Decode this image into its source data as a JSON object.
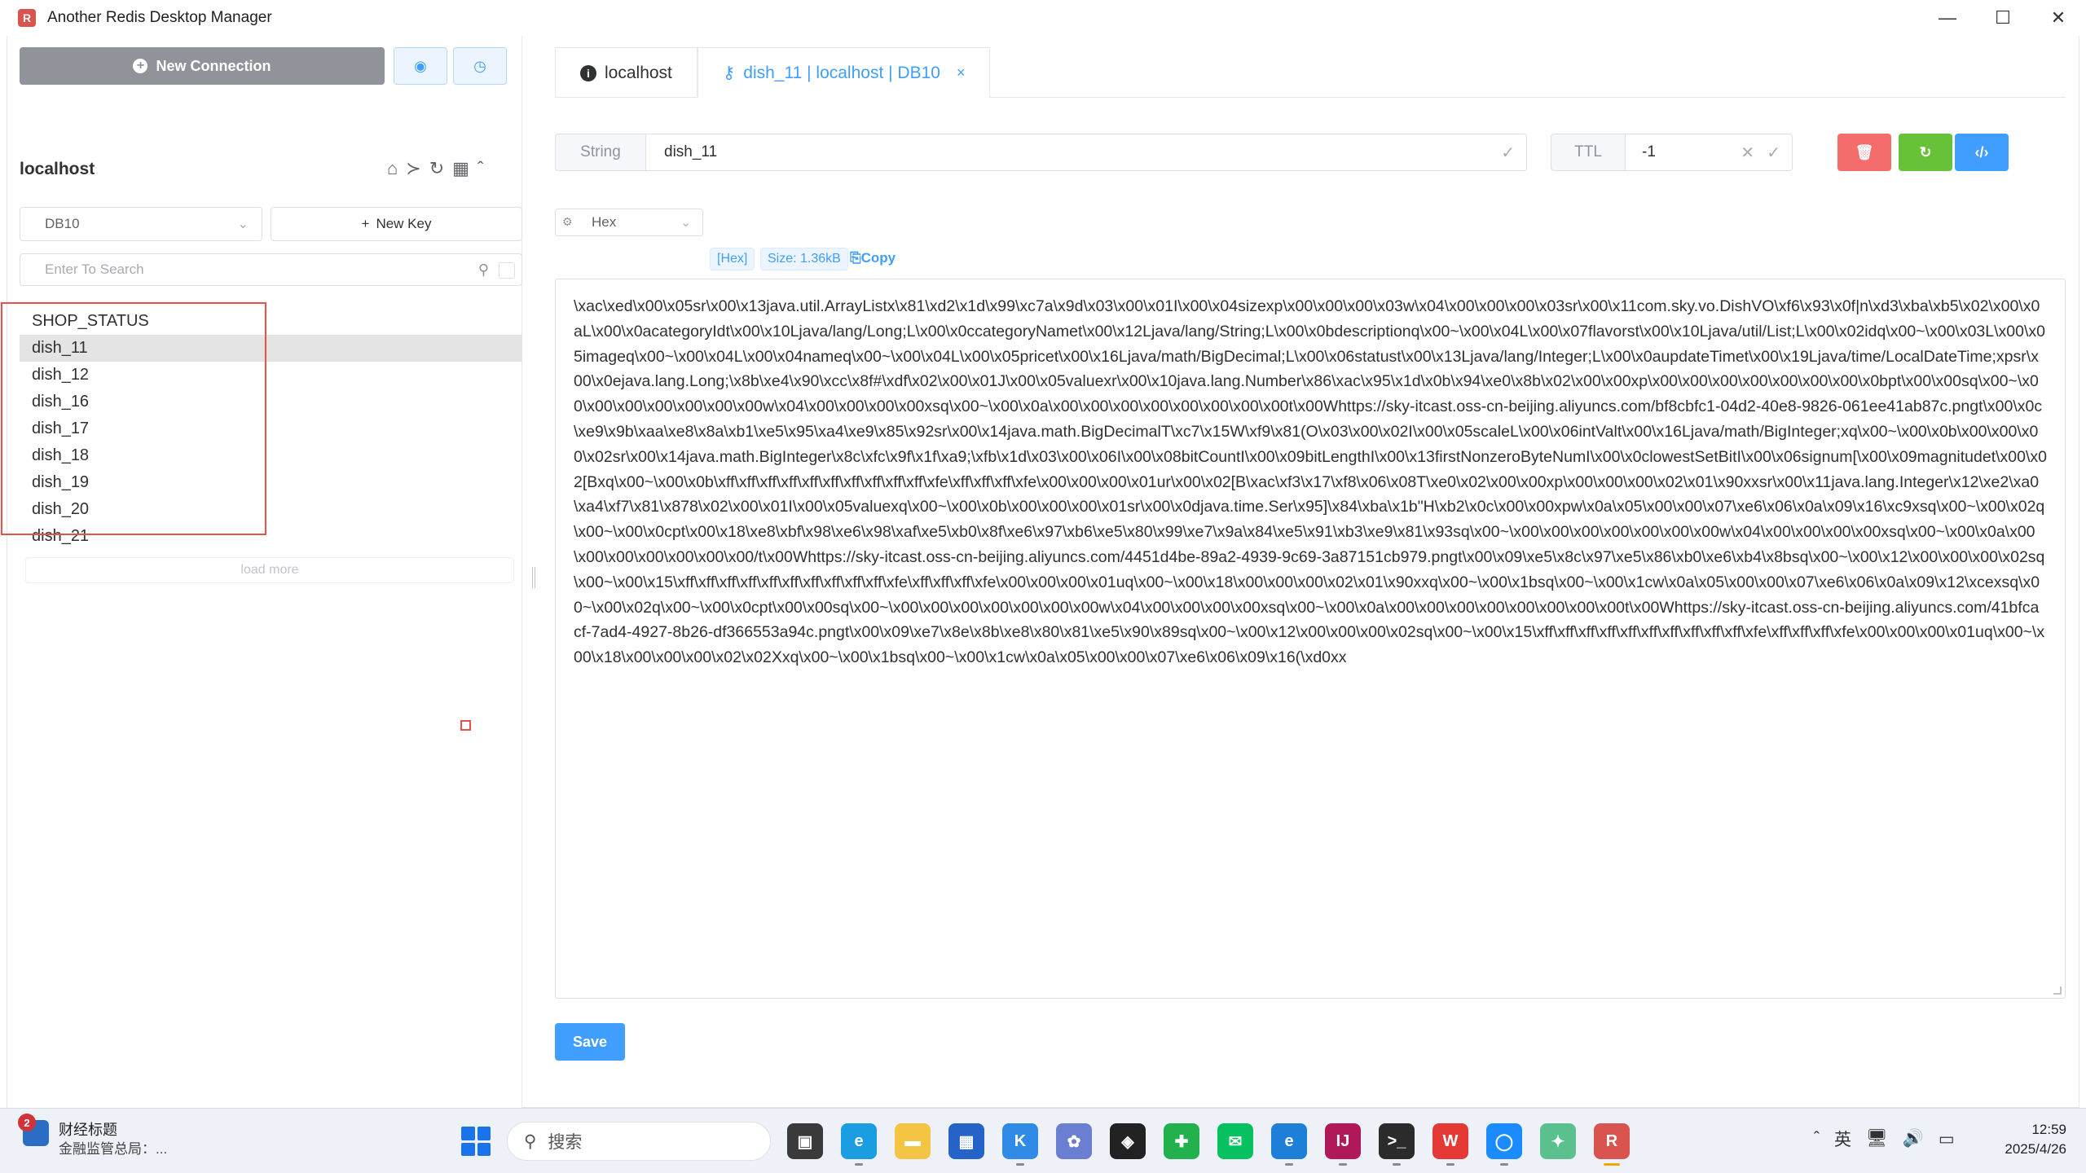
{
  "window": {
    "title": "Another Redis Desktop Manager",
    "minimize_glyph": "—",
    "maximize_glyph": "☐",
    "close_glyph": "✕"
  },
  "sidebar": {
    "new_connection_label": "New Connection",
    "connection_name": "localhost",
    "db_selected": "DB10",
    "new_key_label": "New Key",
    "search_placeholder": "Enter To Search",
    "keys": [
      "SHOP_STATUS",
      "dish_11",
      "dish_12",
      "dish_16",
      "dish_17",
      "dish_18",
      "dish_19",
      "dish_20",
      "dish_21"
    ],
    "active_key": "dish_11",
    "load_more_label": "load more"
  },
  "tabs": [
    {
      "label": "localhost",
      "icon": "info-icon",
      "active": false
    },
    {
      "label": "dish_11 | localhost | DB10",
      "icon": "key-icon",
      "active": true
    }
  ],
  "key_header": {
    "type_label": "String",
    "key_name": "dish_11",
    "ttl_label": "TTL",
    "ttl_value": "-1",
    "colors": {
      "delete": "#f56c6c",
      "refresh": "#67c23a",
      "code": "#409eff"
    }
  },
  "viewer": {
    "format": "Hex",
    "hex_tag": "[Hex]",
    "size_tag": "Size: 1.36kB",
    "copy_label": "Copy",
    "value": "\\xac\\xed\\x00\\x05sr\\x00\\x13java.util.ArrayListx\\x81\\xd2\\x1d\\x99\\xc7a\\x9d\\x03\\x00\\x01I\\x00\\x04sizexp\\x00\\x00\\x00\\x03w\\x04\\x00\\x00\\x00\\x03sr\\x00\\x11com.sky.vo.DishVO\\xf6\\x93\\x0f|n\\xd3\\xba\\xb5\\x02\\x00\\x0aL\\x00\\x0acategoryIdt\\x00\\x10Ljava/lang/Long;L\\x00\\x0ccategoryNamet\\x00\\x12Ljava/lang/String;L\\x00\\x0bdescriptionq\\x00~\\x00\\x04L\\x00\\x07flavorst\\x00\\x10Ljava/util/List;L\\x00\\x02idq\\x00~\\x00\\x03L\\x00\\x05imageq\\x00~\\x00\\x04L\\x00\\x04nameq\\x00~\\x00\\x04L\\x00\\x05pricet\\x00\\x16Ljava/math/BigDecimal;L\\x00\\x06statust\\x00\\x13Ljava/lang/Integer;L\\x00\\x0aupdateTimet\\x00\\x19Ljava/time/LocalDateTime;xpsr\\x00\\x0ejava.lang.Long;\\x8b\\xe4\\x90\\xcc\\x8f#\\xdf\\x02\\x00\\x01J\\x00\\x05valuexr\\x00\\x10java.lang.Number\\x86\\xac\\x95\\x1d\\x0b\\x94\\xe0\\x8b\\x02\\x00\\x00xp\\x00\\x00\\x00\\x00\\x00\\x00\\x00\\x0bpt\\x00\\x00sq\\x00~\\x00\\x00\\x00\\x00\\x00\\x00\\x00w\\x04\\x00\\x00\\x00\\x00xsq\\x00~\\x00\\x0a\\x00\\x00\\x00\\x00\\x00\\x00\\x00\\x00t\\x00Whttps://sky-itcast.oss-cn-beijing.aliyuncs.com/bf8cbfc1-04d2-40e8-9826-061ee41ab87c.pngt\\x00\\x0c\\xe9\\x9b\\xaa\\xe8\\x8a\\xb1\\xe5\\x95\\xa4\\xe9\\x85\\x92sr\\x00\\x14java.math.BigDecimalT\\xc7\\x15W\\xf9\\x81(O\\x03\\x00\\x02I\\x00\\x05scaleL\\x00\\x06intValt\\x00\\x16Ljava/math/BigInteger;xq\\x00~\\x00\\x0b\\x00\\x00\\x00\\x02sr\\x00\\x14java.math.BigInteger\\x8c\\xfc\\x9f\\x1f\\xa9;\\xfb\\x1d\\x03\\x00\\x06I\\x00\\x08bitCountI\\x00\\x09bitLengthI\\x00\\x13firstNonzeroByteNumI\\x00\\x0clowestSetBitI\\x00\\x06signum[\\x00\\x09magnitudet\\x00\\x02[Bxq\\x00~\\x00\\x0b\\xff\\xff\\xff\\xff\\xff\\xff\\xff\\xff\\xff\\xff\\xfe\\xff\\xff\\xff\\xfe\\x00\\x00\\x00\\x01ur\\x00\\x02[B\\xac\\xf3\\x17\\xf8\\x06\\x08T\\xe0\\x02\\x00\\x00xp\\x00\\x00\\x00\\x02\\x01\\x90xxsr\\x00\\x11java.lang.Integer\\x12\\xe2\\xa0\\xa4\\xf7\\x81\\x878\\x02\\x00\\x01I\\x00\\x05valuexq\\x00~\\x00\\x0b\\x00\\x00\\x00\\x01sr\\x00\\x0djava.time.Ser\\x95]\\x84\\xba\\x1b\"H\\xb2\\x0c\\x00\\x00xpw\\x0a\\x05\\x00\\x00\\x07\\xe6\\x06\\x0a\\x09\\x16\\xc9xsq\\x00~\\x00\\x02q\\x00~\\x00\\x0cpt\\x00\\x18\\xe8\\xbf\\x98\\xe6\\x98\\xaf\\xe5\\xb0\\x8f\\xe6\\x97\\xb6\\xe5\\x80\\x99\\xe7\\x9a\\x84\\xe5\\x91\\xb3\\xe9\\x81\\x93sq\\x00~\\x00\\x00\\x00\\x00\\x00\\x00\\x00w\\x04\\x00\\x00\\x00\\x00xsq\\x00~\\x00\\x0a\\x00\\x00\\x00\\x00\\x00\\x00\\x00/t\\x00Whttps://sky-itcast.oss-cn-beijing.aliyuncs.com/4451d4be-89a2-4939-9c69-3a87151cb979.pngt\\x00\\x09\\xe5\\x8c\\x97\\xe5\\x86\\xb0\\xe6\\xb4\\x8bsq\\x00~\\x00\\x12\\x00\\x00\\x00\\x02sq\\x00~\\x00\\x15\\xff\\xff\\xff\\xff\\xff\\xff\\xff\\xff\\xff\\xff\\xfe\\xff\\xff\\xff\\xfe\\x00\\x00\\x00\\x01uq\\x00~\\x00\\x18\\x00\\x00\\x00\\x02\\x01\\x90xxq\\x00~\\x00\\x1bsq\\x00~\\x00\\x1cw\\x0a\\x05\\x00\\x00\\x07\\xe6\\x06\\x0a\\x09\\x12\\xcexsq\\x00~\\x00\\x02q\\x00~\\x00\\x0cpt\\x00\\x00sq\\x00~\\x00\\x00\\x00\\x00\\x00\\x00\\x00w\\x04\\x00\\x00\\x00\\x00xsq\\x00~\\x00\\x0a\\x00\\x00\\x00\\x00\\x00\\x00\\x00\\x00t\\x00Whttps://sky-itcast.oss-cn-beijing.aliyuncs.com/41bfcacf-7ad4-4927-8b26-df366553a94c.pngt\\x00\\x09\\xe7\\x8e\\x8b\\xe8\\x80\\x81\\xe5\\x90\\x89sq\\x00~\\x00\\x12\\x00\\x00\\x00\\x02sq\\x00~\\x00\\x15\\xff\\xff\\xff\\xff\\xff\\xff\\xff\\xff\\xff\\xff\\xfe\\xff\\xff\\xff\\xfe\\x00\\x00\\x00\\x01uq\\x00~\\x00\\x18\\x00\\x00\\x00\\x02\\x02Xxq\\x00~\\x00\\x1bsq\\x00~\\x00\\x1cw\\x0a\\x05\\x00\\x00\\x07\\xe6\\x06\\x09\\x16(\\xd0xx",
    "save_label": "Save"
  },
  "taskbar": {
    "news_badge": "2",
    "news_title": "财经标题",
    "news_sub": "金融监管总局：...",
    "search_placeholder": "搜索",
    "ime": "英",
    "time": "12:59",
    "date": "2025/4/26",
    "apps": [
      {
        "name": "task-view-icon",
        "color": "#3a3a3a",
        "glyph": "▣"
      },
      {
        "name": "edge-icon",
        "color": "#1b9de2",
        "glyph": "e"
      },
      {
        "name": "file-explorer-icon",
        "color": "#f4c542",
        "glyph": "▬"
      },
      {
        "name": "store-icon",
        "color": "#2563c9",
        "glyph": "▦"
      },
      {
        "name": "kuaiyun-icon",
        "color": "#2f8be6",
        "glyph": "K"
      },
      {
        "name": "settings-app-icon",
        "color": "#6a7fd1",
        "glyph": "✿"
      },
      {
        "name": "unity-icon",
        "color": "#222222",
        "glyph": "◈"
      },
      {
        "name": "pycharm-icon",
        "color": "#22b14c",
        "glyph": "✚"
      },
      {
        "name": "wechat-icon",
        "color": "#07c160",
        "glyph": "✉"
      },
      {
        "name": "edge-ai-icon",
        "color": "#1e7fd8",
        "glyph": "e"
      },
      {
        "name": "intellij-icon",
        "color": "#b01859",
        "glyph": "IJ"
      },
      {
        "name": "terminal-icon",
        "color": "#2b2b2b",
        "glyph": ">_"
      },
      {
        "name": "wps-icon",
        "color": "#e53935",
        "glyph": "W"
      },
      {
        "name": "browser-icon",
        "color": "#1a8cff",
        "glyph": "◯"
      },
      {
        "name": "assistant-icon",
        "color": "#5ac18e",
        "glyph": "✦"
      },
      {
        "name": "redis-manager-icon",
        "color": "#d9534f",
        "glyph": "R"
      }
    ]
  }
}
